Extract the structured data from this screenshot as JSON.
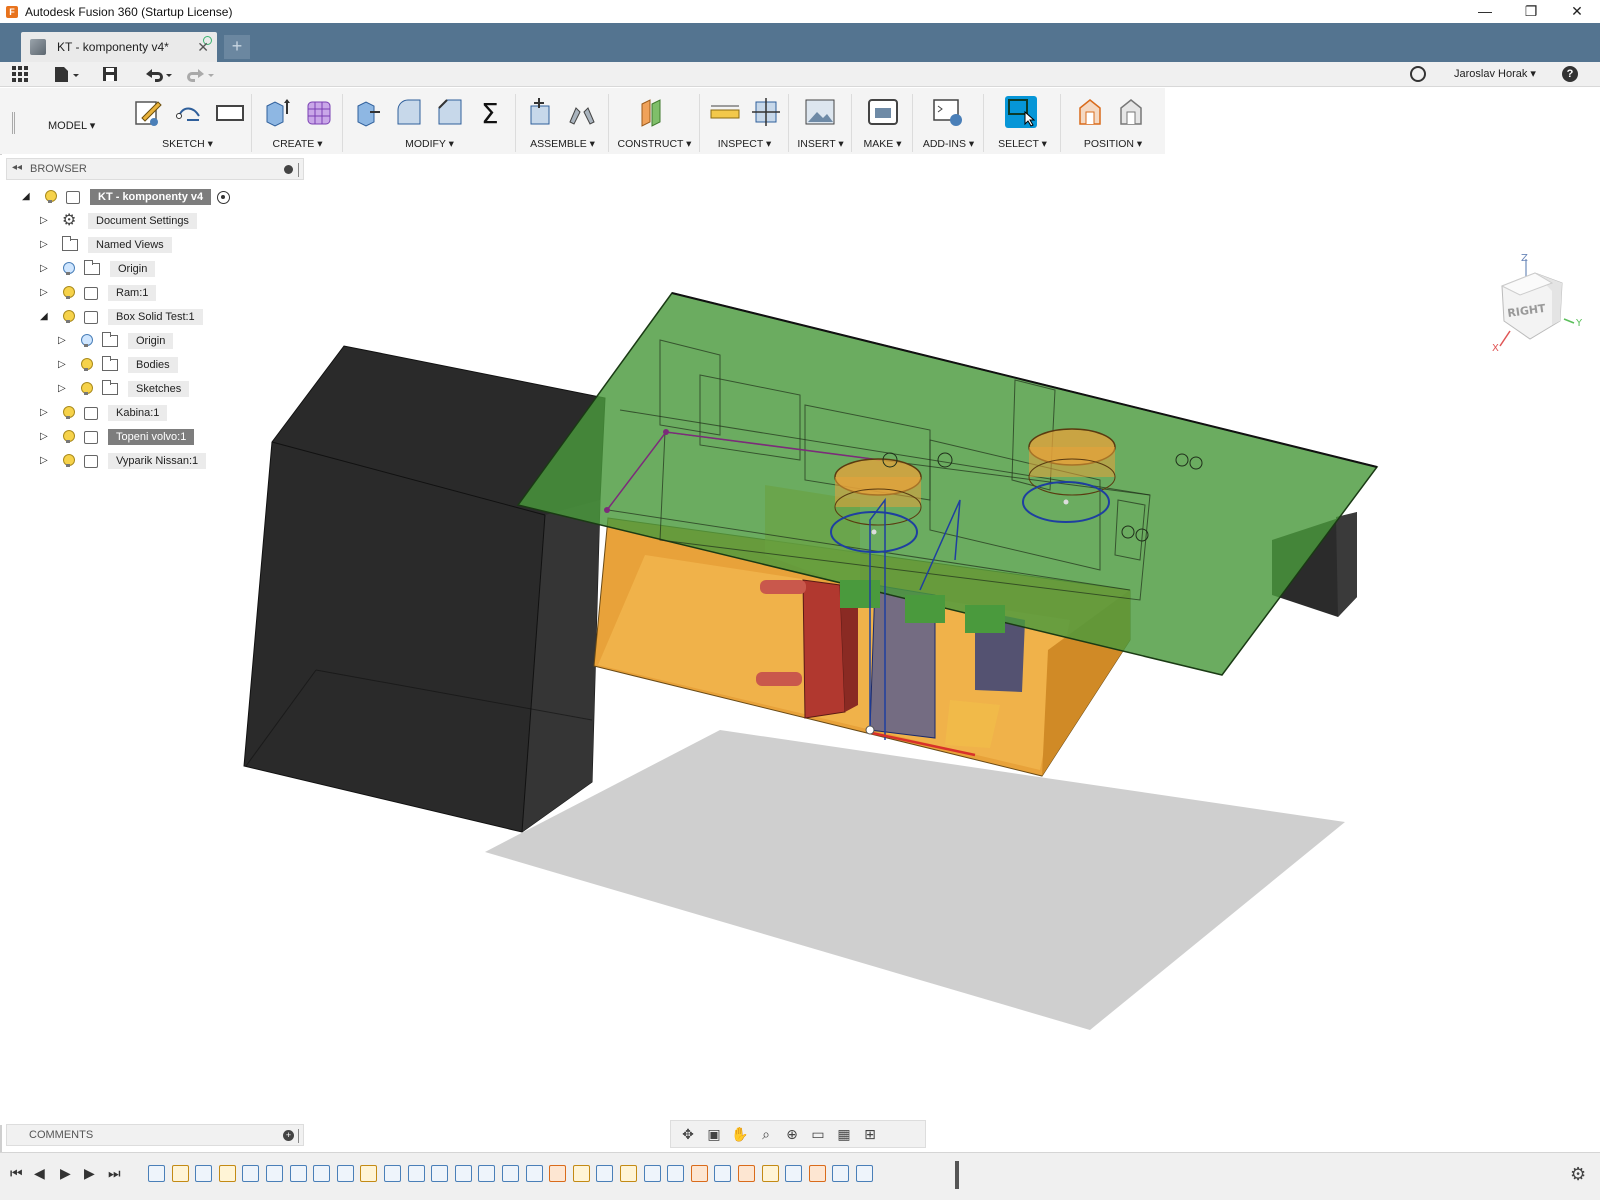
{
  "window": {
    "title": "Autodesk Fusion 360 (Startup License)",
    "app_icon_letter": "F",
    "minimize": "—",
    "maximize": "❐",
    "close": "✕"
  },
  "tabs": {
    "active_label": "KT - komponenty v4*",
    "close": "✕",
    "new_tab": "+"
  },
  "quick_access": {
    "user": "Jaroslav Horak ▾",
    "help": "?"
  },
  "toolbar": {
    "workspace": "MODEL ▾",
    "groups": {
      "sketch": "SKETCH ▾",
      "create": "CREATE ▾",
      "modify": "MODIFY ▾",
      "assemble": "ASSEMBLE ▾",
      "construct": "CONSTRUCT ▾",
      "inspect": "INSPECT ▾",
      "insert": "INSERT ▾",
      "make": "MAKE ▾",
      "addins": "ADD-INS ▾",
      "select": "SELECT ▾",
      "position": "POSITION ▾"
    }
  },
  "browser": {
    "title": "BROWSER",
    "collapse": "◂◂",
    "items": [
      {
        "label": "KT - komponenty v4"
      },
      {
        "label": "Document Settings"
      },
      {
        "label": "Named Views"
      },
      {
        "label": "Origin"
      },
      {
        "label": "Ram:1"
      },
      {
        "label": "Box Solid Test:1"
      },
      {
        "label": "Origin"
      },
      {
        "label": "Bodies"
      },
      {
        "label": "Sketches"
      },
      {
        "label": "Kabina:1"
      },
      {
        "label": "Topeni volvo:1"
      },
      {
        "label": "Vyparik Nissan:1"
      }
    ]
  },
  "viewcube": {
    "face": "RIGHT",
    "axis_z": "Z",
    "axis_y": "Y",
    "axis_x": "X"
  },
  "comments": {
    "title": "COMMENTS",
    "add": "+"
  },
  "colors": {
    "tabbar": "#547490",
    "accent_select": "#0696d7",
    "green_plane": "#4a9a3d",
    "orange_box": "#e8a23a",
    "black_block": "#2b2b2b"
  }
}
